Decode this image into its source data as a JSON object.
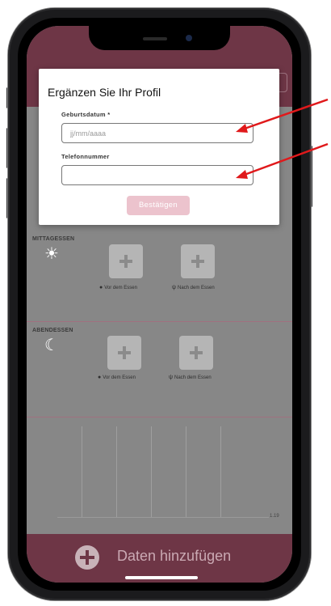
{
  "modal": {
    "title": "Ergänzen Sie Ihr Profil",
    "birthdate_label": "Geburtsdatum *",
    "birthdate_placeholder": "jj/mm/aaaa",
    "birthdate_value": "",
    "phone_label": "Telefonnummer",
    "phone_value": "",
    "confirm_label": "Bestätigen"
  },
  "sections": [
    {
      "label": "MITTAGESSEN",
      "icon": "sun-icon",
      "tiles": [
        {
          "label": "Vor dem Essen",
          "icon": "apple-icon"
        },
        {
          "label": "Nach dem Essen",
          "icon": "fork-knife-icon"
        }
      ]
    },
    {
      "label": "ABENDESSEN",
      "icon": "moon-icon",
      "tiles": [
        {
          "label": "Vor dem Essen",
          "icon": "apple-icon"
        },
        {
          "label": "Nach dem Essen",
          "icon": "fork-knife-icon"
        }
      ]
    }
  ],
  "chart": {
    "value_label": "1.19"
  },
  "footer": {
    "add_label": "Daten hinzufügen"
  },
  "colors": {
    "brand": "#6e3646",
    "button_disabled": "#ecc3cd",
    "arrow": "#e0191b"
  }
}
